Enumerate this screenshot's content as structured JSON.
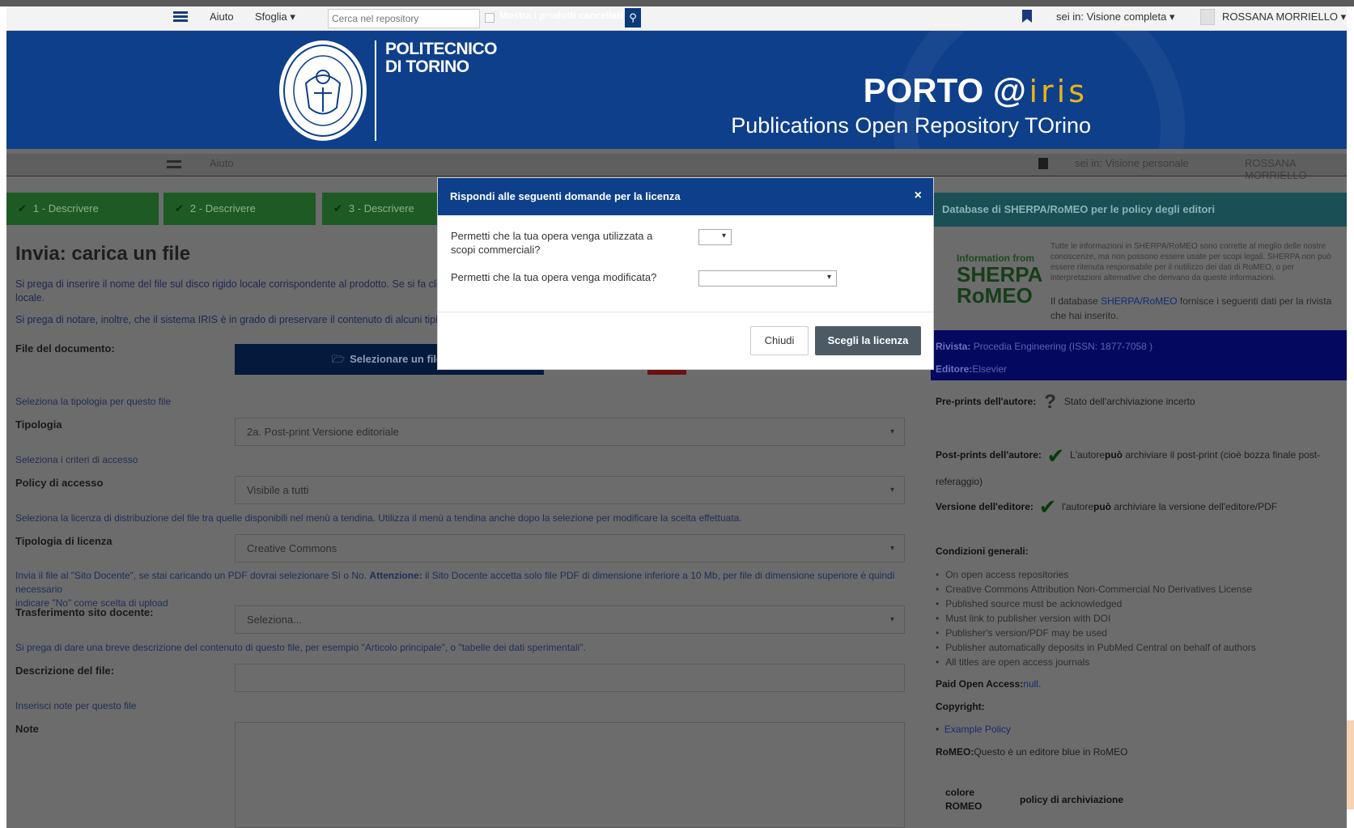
{
  "topnav": {
    "help": "Aiuto",
    "browse": "Sfoglia",
    "search_placeholder": "Cerca nel repository",
    "search_checkbox_label": "Mostra i prodotti cancellati",
    "view": "sei in: Visione completa",
    "user": "ROSSANA MORRIELLO"
  },
  "banner": {
    "institution_line1": "POLITECNICO",
    "institution_line2": "DI TORINO",
    "brand": "PORTO @",
    "brand_suffix": "IRIS",
    "subtitle": "Publications Open Repository TOrino"
  },
  "ghostnav": {
    "help": "Aiuto",
    "view": "sei in: Visione personale",
    "user": "ROSSANA MORRIELLO"
  },
  "steps": [
    "1 - Descrivere",
    "2 - Descrivere",
    "3 - Descrivere"
  ],
  "form": {
    "title": "Invia: carica un file",
    "intro1": "Si prega di inserire il nome del file sul disco rigido locale corrispondente al prodotto. Se si fa clic",
    "intro1b": "locale.",
    "intro2": "Si prega di notare, inoltre, che il sistema IRIS è in grado di preservare il contenuto di alcuni tipi d",
    "file_label": "File del documento:",
    "upload_button": "Selezionare un file",
    "type_hint": "Seleziona la tipologia per questo file",
    "type_label": "Tipologia",
    "type_value": "2a. Post-print Versione editoriale",
    "access_hint": "Seleziona i criteri di accesso",
    "access_label": "Policy di accesso",
    "access_value": "Visibile a tutti",
    "license_hint": "Seleziona la licenza di distribuzione del file tra quelle disponibili nel menù a tendina. Utilizza il menù a tendina anche dopo la selezione per modificare la scelta effettuata.",
    "license_label": "Tipologia di licenza",
    "license_value": "Creative Commons",
    "docente_hint_pre": "Invia il file al \"Sito Docente\", se stai caricando un PDF dovrai selezionare Sì o No.",
    "docente_hint_bold": "Attenzione:",
    "docente_hint_post": "il Sito Docente accetta solo file PDF di dimensione inferiore a 10 Mb, per file di dimensione superiore è quindi necessario",
    "docente_hint_line2": "indicare \"No\" come scelta di upload",
    "docente_label": "Trasferimento sito docente:",
    "docente_value": "Seleziona...",
    "desc_hint": "Si prega di dare una breve descrizione del contenuto di questo file, per esempio \"Articolo principale\", o \"tabelle dei dati sperimentali\".",
    "desc_label": "Descrizione del file:",
    "notes_hint": "Inserisci note per questo file",
    "notes_label": "Note"
  },
  "sherpa": {
    "header": "Database di SHERPA/RoMEO per le policy degli editori",
    "logo_small": "Information from",
    "logo_line1": "SHERPA",
    "logo_line2": "RoMEO",
    "disclaimer": "Tutte le informazioni in SHERPA/RoMEO sono corrette al meglio delle nostre conoscenze, ma non possono essere usate per scopi legali. SHERPA non può essere ritenuta responsabile per il nutilizzo dei dati di RoMEO, o per interpretazioni alternative che derivano da queste informazioni.",
    "db_pre": "Il database",
    "db_link": "SHERPA/RoMEO",
    "db_post": "fornisce i seguenti dati per la rivista che hai inserito.",
    "journal_label": "Rivista:",
    "journal_value": "Procedia Engineering (ISSN: 1877-7058 )",
    "publisher_label": "Editore:",
    "publisher_value": "Elsevier",
    "preprint_label": "Pre-prints dell'autore:",
    "preprint_value": "Stato dell'archiviazione incerto",
    "postprint_label": "Post-prints dell'autore:",
    "postprint_value_pre": "L'autore",
    "postprint_value_bold": "può",
    "postprint_value_post": "archiviare il post-print (cioè bozza finale post-",
    "postprint_value_line2": "referaggio)",
    "version_label": "Versione dell'editore:",
    "version_value_pre": "l'autore",
    "version_value_bold": "può",
    "version_value_post": "archiviare la versione dell'editore/PDF",
    "conditions_label": "Condizioni generali:",
    "conditions": [
      "On open access repositories",
      "Creative Commons Attribution Non-Commercial No Derivatives License",
      "Published source must be acknowledged",
      "Must link to publisher version with DOI",
      "Publisher's version/PDF may be used",
      "Publisher automatically deposits in PubMed Central on behalf of authors",
      "All titles are open access journals"
    ],
    "paid_label": "Paid Open Access:",
    "paid_value": "null.",
    "copyright_label": "Copyright:",
    "copyright_link": "Example Policy",
    "romeo_label": "RoMEO:",
    "romeo_value": "Questo è un editore blue in RoMEO",
    "col1_line1": "colore",
    "col1_line2": "ROMEO",
    "col2": "policy di archiviazione"
  },
  "modal": {
    "title": "Rispondi alle seguenti domande per la licenza",
    "close_icon": "×",
    "q1": "Permetti che la tua opera venga utilizzata a scopi commerciali?",
    "q2": "Permetti che la tua opera venga modificata?",
    "close_button": "Chiudi",
    "choose_button": "Scegli la licenza"
  },
  "icons": {
    "caret": "▾",
    "check": "✔",
    "question": "?",
    "search": "⚲",
    "folder": "🗁"
  }
}
